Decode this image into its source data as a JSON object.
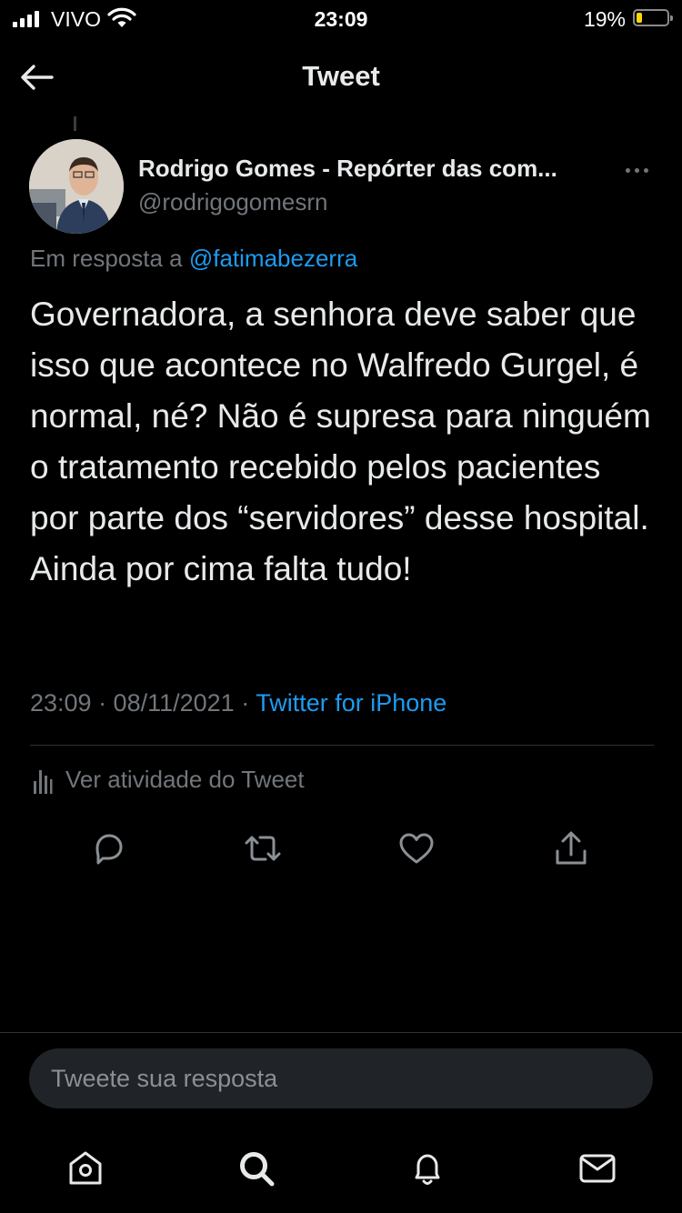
{
  "status_bar": {
    "carrier": "VIVO",
    "time": "23:09",
    "battery_percent": "19%",
    "battery_level": 0.19,
    "battery_color": "#ffd60a"
  },
  "header": {
    "title": "Tweet",
    "back_icon": "arrow-left-icon"
  },
  "tweet": {
    "author_name": "Rodrigo Gomes - Repórter das com...",
    "author_handle": "@rodrigogomesrn",
    "reply_to_prefix": "Em resposta a ",
    "reply_to_handle": "@fatimabezerra",
    "text": "Governadora, a senhora deve saber que isso que acontece no Walfredo Gurgel, é normal, né? Não é supresa para ninguém o tratamento recebido pelos pacientes por parte dos “servidores” desse hospital. Ainda por cima falta tudo!",
    "timestamp": "23:09 · 08/11/2021 · ",
    "source": "Twitter for iPhone",
    "activity_label": "Ver atividade do Tweet"
  },
  "actions": {
    "reply_icon": "comment-icon",
    "retweet_icon": "retweet-icon",
    "like_icon": "heart-icon",
    "share_icon": "share-icon"
  },
  "reply_box": {
    "placeholder": "Tweete sua resposta"
  },
  "tabbar": {
    "items": [
      "home-icon",
      "search-icon",
      "bell-icon",
      "mail-icon"
    ]
  },
  "colors": {
    "background": "#000000",
    "text": "#e7e9ea",
    "secondary": "#71767b",
    "accent": "#1d9bf0"
  }
}
